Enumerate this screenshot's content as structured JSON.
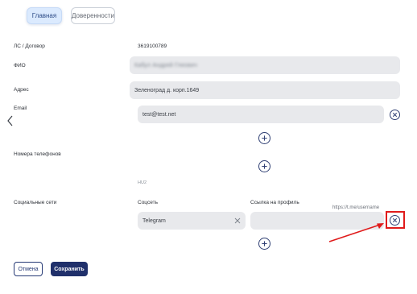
{
  "tabs": {
    "main": "Главная",
    "proxies": "Доверенности"
  },
  "account": {
    "label": "ЛС / Договор",
    "value": "3619100789"
  },
  "fio": {
    "label": "ФИО",
    "value": "Кабул Андрей Глеович"
  },
  "address": {
    "label": "Адрес",
    "value": "Зеленоград д. корп.1649"
  },
  "email": {
    "label": "Email",
    "value": "test@test.net"
  },
  "phones": {
    "label": "Номера телефонов",
    "hint": "HU2"
  },
  "social": {
    "label": "Социальные сети",
    "col_network": "Соцсеть",
    "col_link": "Ссылка на профиль",
    "network_value": "Telegram",
    "link_placeholder": "https://t.me/username"
  },
  "actions": {
    "cancel": "Отмена",
    "save": "Сохранить"
  },
  "colors": {
    "accent": "#20306b",
    "highlight": "#e01b1b",
    "field_bg": "#e8e9ec",
    "tab_active_bg": "#dbeafe"
  }
}
